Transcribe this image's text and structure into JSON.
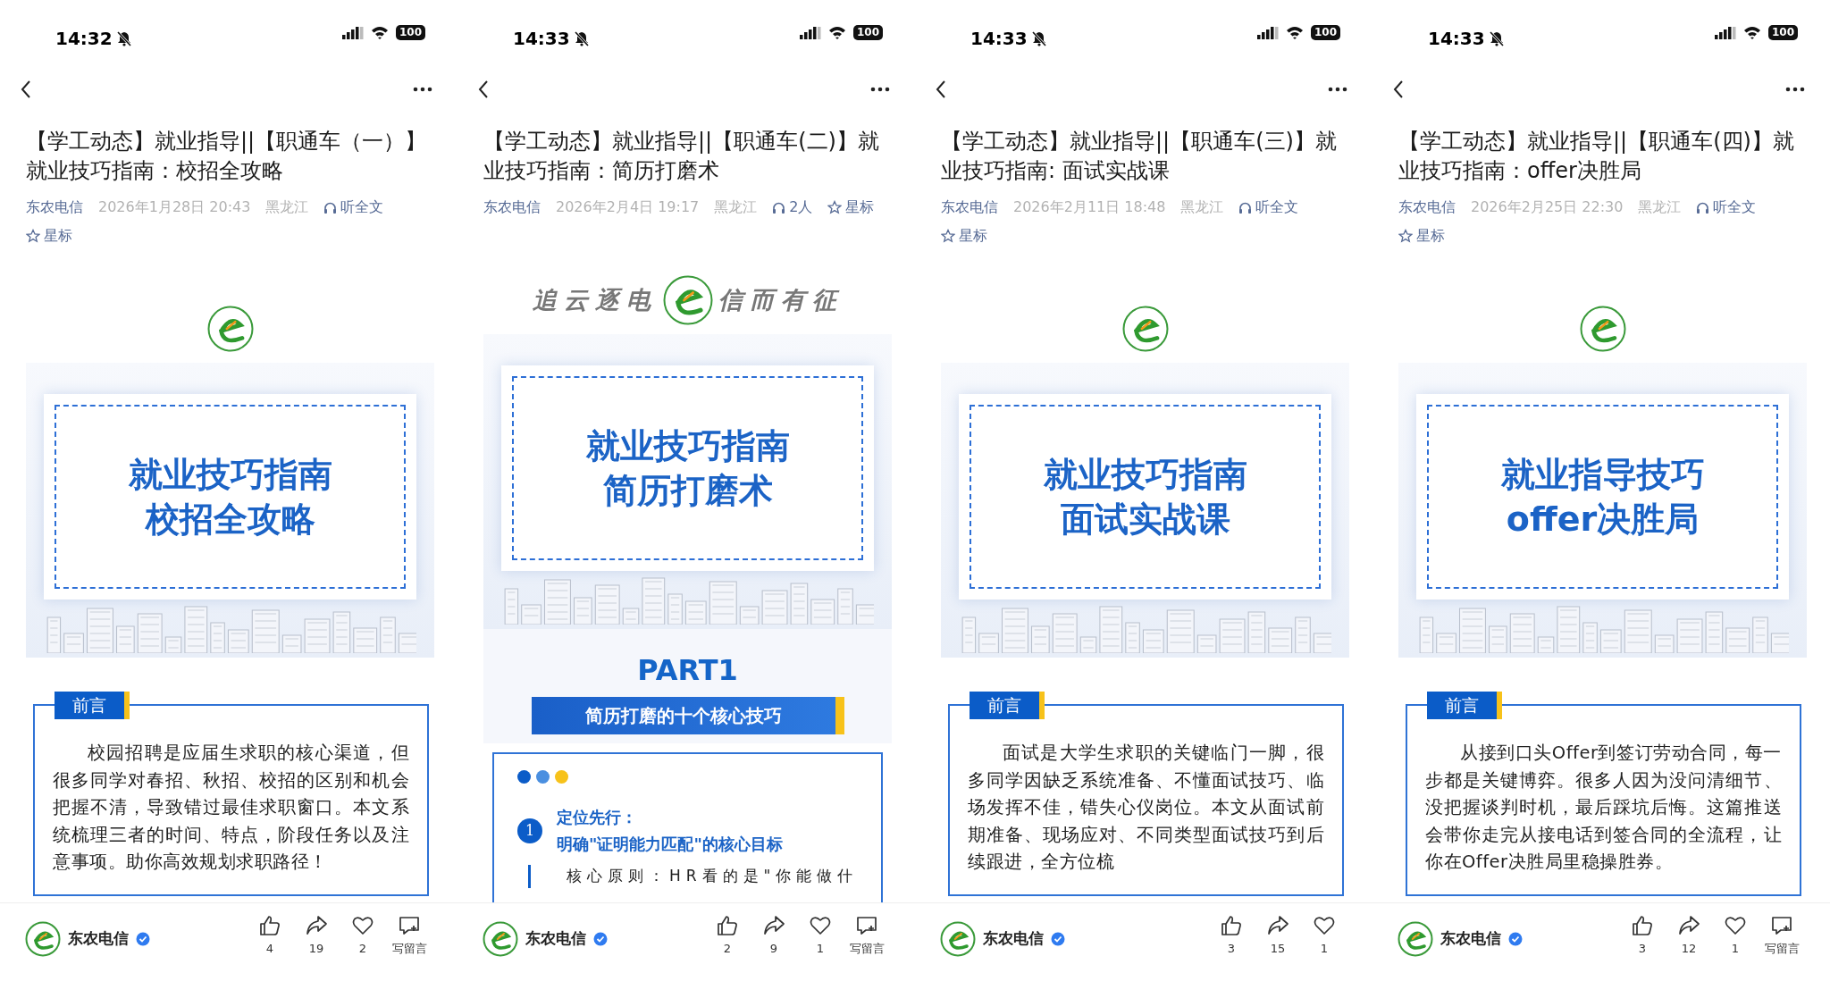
{
  "screens": [
    {
      "status": {
        "time": "14:32",
        "battery": "100"
      },
      "title": "【学工动态】就业指导||【职通车（一）】就业技巧指南：校招全攻略",
      "meta": {
        "account": "东农电信",
        "date": "2026年1月28日 20:43",
        "region": "黑龙江",
        "listen": "听全文",
        "star": "星标"
      },
      "blocks": [
        {
          "kind": "logo"
        },
        {
          "kind": "cover",
          "lines": [
            "就业技巧指南",
            "校招全攻略"
          ]
        },
        {
          "kind": "preface",
          "tag": "前言",
          "text": "校园招聘是应届生求职的核心渠道，但很多同学对春招、秋招、校招的区别和机会把握不清，导致错过最佳求职窗口。本文系统梳理三者的时间、特点，阶段任务以及注意事项。助你高效规划求职路径！"
        }
      ],
      "footer": {
        "account": "东农电信",
        "likes": "4",
        "shares": "19",
        "favorites": "2",
        "comment": "写留言"
      }
    },
    {
      "status": {
        "time": "14:33",
        "battery": "100"
      },
      "title": "【学工动态】就业指导||【职通车(二)】就业技巧指南：简历打磨术",
      "meta": {
        "account": "东农电信",
        "date": "2026年2月4日 19:17",
        "region": "黑龙江",
        "listen": "2人",
        "star": "星标"
      },
      "blocks": [
        {
          "kind": "slogan",
          "left": "追云逐电",
          "right": "信而有征"
        },
        {
          "kind": "cover",
          "lines": [
            "就业技巧指南",
            "简历打磨术"
          ]
        },
        {
          "kind": "part",
          "label": "PART1",
          "subtitle": "简历打磨的十个核心技巧"
        },
        {
          "kind": "tip",
          "number": "1",
          "heading": "定位先行：",
          "subheading": "明确\"证明能力匹配\"的核心目标",
          "text": "核心原则：HR看的是\"你能做什"
        }
      ],
      "footer": {
        "account": "东农电信",
        "likes": "2",
        "shares": "9",
        "favorites": "1",
        "comment": "写留言"
      }
    },
    {
      "status": {
        "time": "14:33",
        "battery": "100"
      },
      "title": "【学工动态】就业指导||【职通车(三)】就业技巧指南: 面试实战课",
      "meta": {
        "account": "东农电信",
        "date": "2026年2月11日 18:48",
        "region": "黑龙江",
        "listen": "听全文",
        "star": "星标"
      },
      "blocks": [
        {
          "kind": "logo"
        },
        {
          "kind": "cover",
          "lines": [
            "就业技巧指南",
            "面试实战课"
          ]
        },
        {
          "kind": "preface",
          "tag": "前言",
          "text": "面试是大学生求职的关键临门一脚，很多同学因缺乏系统准备、不懂面试技巧、临场发挥不佳，错失心仪岗位。本文从面试前期准备、现场应对、不同类型面试技巧到后续跟进，全方位梳"
        }
      ],
      "footer": {
        "account": "东农电信",
        "likes": "3",
        "shares": "15",
        "favorites": "1"
      }
    },
    {
      "status": {
        "time": "14:33",
        "battery": "100"
      },
      "title": "【学工动态】就业指导||【职通车(四)】就业技巧指南：offer决胜局",
      "meta": {
        "account": "东农电信",
        "date": "2026年2月25日 22:30",
        "region": "黑龙江",
        "listen": "听全文",
        "star": "星标"
      },
      "blocks": [
        {
          "kind": "logo"
        },
        {
          "kind": "cover",
          "lines": [
            "就业指导技巧",
            "offer决胜局"
          ]
        },
        {
          "kind": "preface",
          "tag": "前言",
          "text": "从接到口头Offer到签订劳动合同，每一步都是关键博弈。很多人因为没问清细节、没把握谈判时机，最后踩坑后悔。这篇推送会带你走完从接电话到签合同的全流程，让你在Offer决胜局里稳操胜券。"
        }
      ],
      "footer": {
        "account": "东农电信",
        "likes": "3",
        "shares": "12",
        "favorites": "1",
        "comment": "写留言"
      }
    }
  ]
}
